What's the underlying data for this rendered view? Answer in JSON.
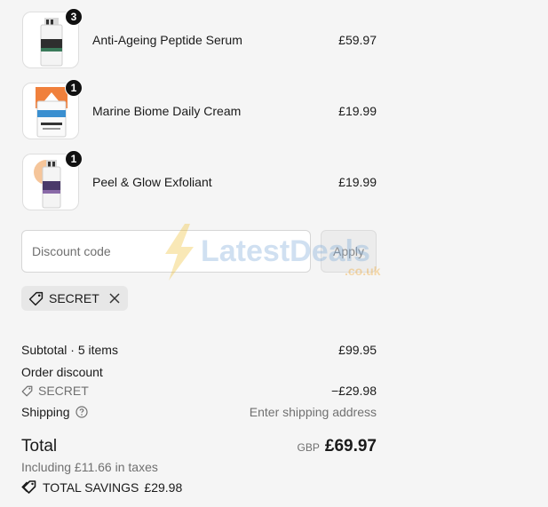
{
  "line_items": [
    {
      "name": "Anti-Ageing Peptide Serum",
      "price": "£59.97",
      "quantity": "3",
      "image_icon": "serum-bottle-icon",
      "accent": "#2e2e2e"
    },
    {
      "name": "Marine Biome Daily Cream",
      "price": "£19.99",
      "quantity": "1",
      "image_icon": "cream-tube-icon",
      "accent": "#3a8fd0"
    },
    {
      "name": "Peel & Glow Exfoliant",
      "price": "£19.99",
      "quantity": "1",
      "image_icon": "exfoliant-bottle-icon",
      "accent": "#4a3a6a"
    }
  ],
  "discount": {
    "placeholder": "Discount code",
    "apply_label": "Apply",
    "applied_code": "SECRET"
  },
  "summary": {
    "subtotal_label": "Subtotal · 5 items",
    "subtotal_value": "£99.95",
    "order_discount_label": "Order discount",
    "discount_code": "SECRET",
    "discount_value": "−£29.98",
    "shipping_label": "Shipping",
    "shipping_value": "Enter shipping address",
    "total_label": "Total",
    "currency": "GBP",
    "total_value": "£69.97",
    "taxes_text": "Including £11.66 in taxes",
    "savings_label": "TOTAL SAVINGS",
    "savings_value": "£29.98"
  },
  "watermark": {
    "brand": "LatestDeals",
    "domain": ".co.uk"
  }
}
